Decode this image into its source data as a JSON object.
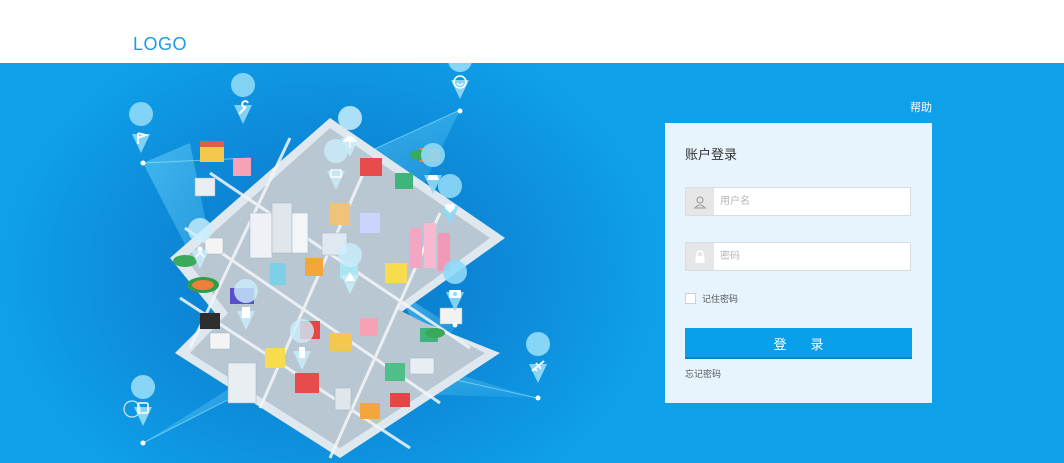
{
  "header": {
    "logo": "LOGO"
  },
  "help_link": "帮助",
  "login": {
    "title": "账户登录",
    "username_placeholder": "用户名",
    "password_placeholder": "密码",
    "remember_label": "记住密码",
    "submit_label": "登录",
    "forgot_label": "忘记密码"
  },
  "colors": {
    "brand": "#1a9be6",
    "hero_bg": "#0fa0ea",
    "button": "#08a0eb",
    "panel": "#e7f4fd"
  },
  "illustration": {
    "pins": [
      "flag-icon",
      "wrench-icon",
      "smile-icon",
      "umbrella-icon",
      "cart-icon",
      "car-icon",
      "person-icon",
      "tree-icon",
      "heart-icon",
      "building-icon",
      "camera-icon",
      "cart-icon",
      "heart-icon",
      "phone-icon",
      "plane-icon",
      "bus-icon"
    ]
  }
}
